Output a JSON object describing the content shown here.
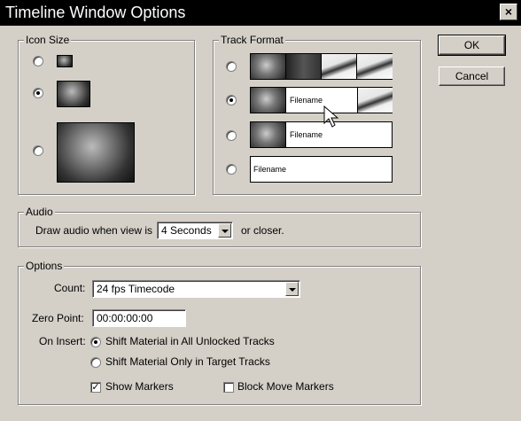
{
  "window": {
    "title": "Timeline Window Options"
  },
  "buttons": {
    "ok": "OK",
    "cancel": "Cancel"
  },
  "icon_size": {
    "label": "Icon Size",
    "options": [
      {
        "selected": false
      },
      {
        "selected": true
      },
      {
        "selected": false
      }
    ]
  },
  "track_format": {
    "label": "Track Format",
    "options": [
      {
        "selected": false,
        "filename": ""
      },
      {
        "selected": true,
        "filename": "Filename"
      },
      {
        "selected": false,
        "filename": "Filename"
      },
      {
        "selected": false,
        "filename": "Filename"
      }
    ]
  },
  "audio": {
    "label": "Audio",
    "prefix": "Draw audio when view is",
    "value": "4 Seconds",
    "suffix": "or closer."
  },
  "options": {
    "label": "Options",
    "count_label": "Count:",
    "count_value": "24 fps Timecode",
    "zero_point_label": "Zero Point:",
    "zero_point_value": "00:00:00:00",
    "on_insert_label": "On Insert:",
    "insert_options": [
      {
        "label": "Shift Material in All Unlocked Tracks",
        "selected": true
      },
      {
        "label": "Shift Material Only in Target Tracks",
        "selected": false
      }
    ],
    "show_markers": {
      "label": "Show Markers",
      "checked": true
    },
    "block_move_markers": {
      "label": "Block Move Markers",
      "checked": false
    }
  }
}
